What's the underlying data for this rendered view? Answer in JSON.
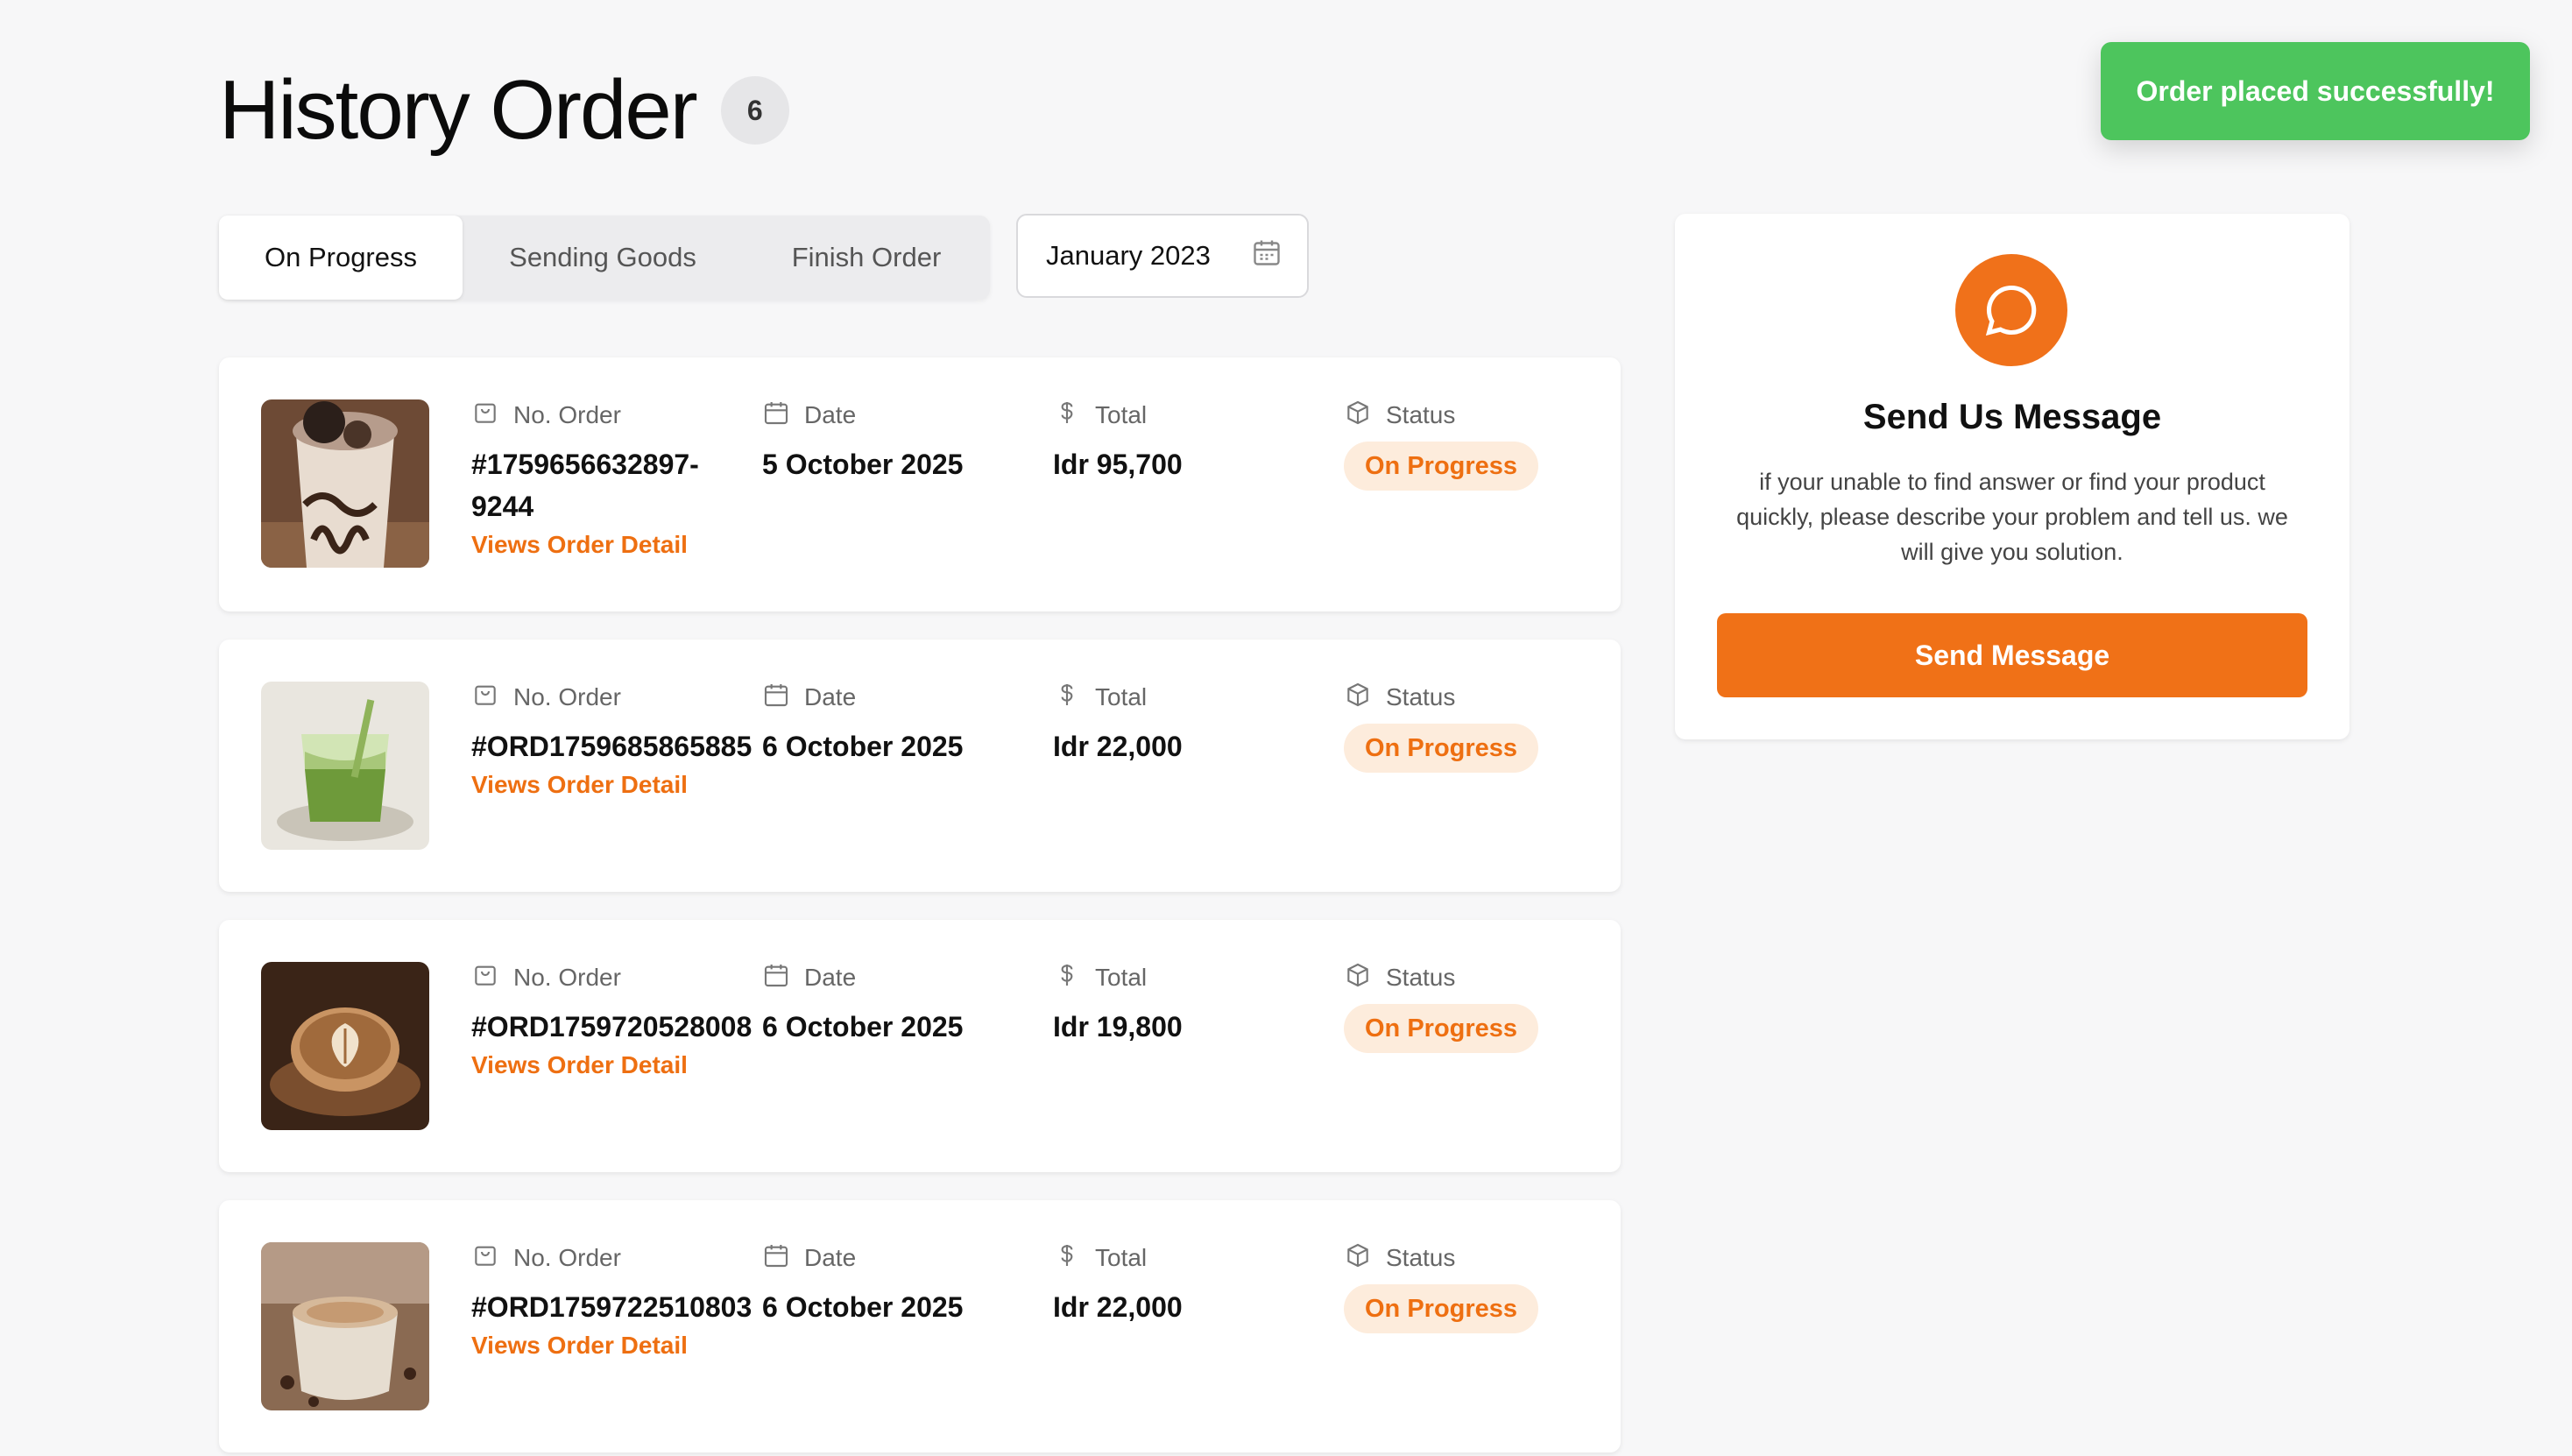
{
  "header": {
    "title": "History Order",
    "count": "6"
  },
  "tabs": [
    {
      "label": "On Progress",
      "active": true
    },
    {
      "label": "Sending Goods",
      "active": false
    },
    {
      "label": "Finish Order",
      "active": false
    }
  ],
  "date_filter": {
    "value": "January 2023",
    "icon": "calendar-icon"
  },
  "columns": {
    "order": "No. Order",
    "date": "Date",
    "total": "Total",
    "status": "Status"
  },
  "orders": [
    {
      "order_no": "#1759656632897-9244",
      "date": "5 October 2025",
      "total": "Idr 95,700",
      "status": "On Progress",
      "link": "Views Order Detail",
      "image": "cookies-frappe-drink"
    },
    {
      "order_no": "#ORD1759685865885",
      "date": "6 October 2025",
      "total": "Idr 22,000",
      "status": "On Progress",
      "link": "Views Order Detail",
      "image": "matcha-latte-drink"
    },
    {
      "order_no": "#ORD1759720528008",
      "date": "6 October 2025",
      "total": "Idr 19,800",
      "status": "On Progress",
      "link": "Views Order Detail",
      "image": "latte-art-coffee"
    },
    {
      "order_no": "#ORD1759722510803",
      "date": "6 October 2025",
      "total": "Idr 22,000",
      "status": "On Progress",
      "link": "Views Order Detail",
      "image": "cappuccino-cup"
    }
  ],
  "message_card": {
    "title": "Send Us Message",
    "description": "if your unable to find answer or find your product quickly, please describe your problem and tell us. we will give you solution.",
    "button": "Send Message",
    "icon": "chat-bubble-icon"
  },
  "toast": {
    "text": "Order placed successfully!"
  },
  "colors": {
    "accent": "#f07117",
    "success": "#4dc55d",
    "status_bg": "#fdecdc"
  }
}
